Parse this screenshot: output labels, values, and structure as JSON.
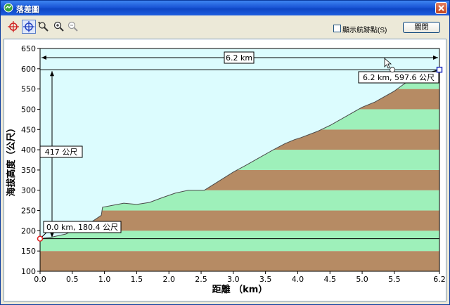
{
  "window": {
    "title": "落差圖"
  },
  "toolbar": {
    "tools": [
      "crosshair-red-icon",
      "crosshair-blue-icon",
      "pan-icon",
      "zoom-in-icon",
      "zoom-out-icon"
    ],
    "show_track_label": "顯示航跡點(S)",
    "close_label": "關閉"
  },
  "colors": {
    "sky": "#dcfcfe",
    "band_dark": "#b68b64",
    "band_light": "#9ef0ba",
    "start_marker": "#e02020",
    "end_marker": "#2030c0"
  },
  "chart_data": {
    "type": "area",
    "xlabel": "距離 （km）",
    "ylabel": "海拔高度（公尺）",
    "xlim": [
      0.0,
      6.2
    ],
    "ylim": [
      100,
      650
    ],
    "xticks": [
      "0.0",
      "0.5",
      "1.0",
      "1.5",
      "2.0",
      "2.5",
      "3.0",
      "3.5",
      "4.0",
      "4.5",
      "5.0",
      "5.5",
      "6.2"
    ],
    "yticks": [
      "100",
      "150",
      "200",
      "250",
      "300",
      "350",
      "400",
      "450",
      "500",
      "550",
      "600",
      "650"
    ],
    "bands": [
      100,
      150,
      200,
      250,
      300,
      350,
      400,
      450,
      500,
      550,
      600
    ],
    "profile": [
      [
        0.0,
        180.4
      ],
      [
        0.2,
        185
      ],
      [
        0.4,
        192
      ],
      [
        0.6,
        208
      ],
      [
        0.8,
        222
      ],
      [
        0.95,
        238
      ],
      [
        0.97,
        258
      ],
      [
        1.1,
        262
      ],
      [
        1.3,
        268
      ],
      [
        1.5,
        265
      ],
      [
        1.7,
        270
      ],
      [
        1.9,
        282
      ],
      [
        2.1,
        293
      ],
      [
        2.3,
        300
      ],
      [
        2.55,
        300
      ],
      [
        2.8,
        325
      ],
      [
        3.0,
        345
      ],
      [
        3.2,
        362
      ],
      [
        3.4,
        380
      ],
      [
        3.6,
        398
      ],
      [
        3.8,
        415
      ],
      [
        3.95,
        425
      ],
      [
        4.05,
        430
      ],
      [
        4.3,
        445
      ],
      [
        4.5,
        460
      ],
      [
        4.7,
        478
      ],
      [
        5.0,
        505
      ],
      [
        5.2,
        518
      ],
      [
        5.5,
        545
      ],
      [
        5.7,
        568
      ],
      [
        5.9,
        578
      ],
      [
        6.05,
        590
      ],
      [
        6.2,
        597.6
      ]
    ],
    "annotations": {
      "distance": "6.2 km",
      "elevation_gain": "417 公尺",
      "start": "0.0 km, 180.4 公尺",
      "end": "6.2 km, 597.6 公尺"
    }
  }
}
